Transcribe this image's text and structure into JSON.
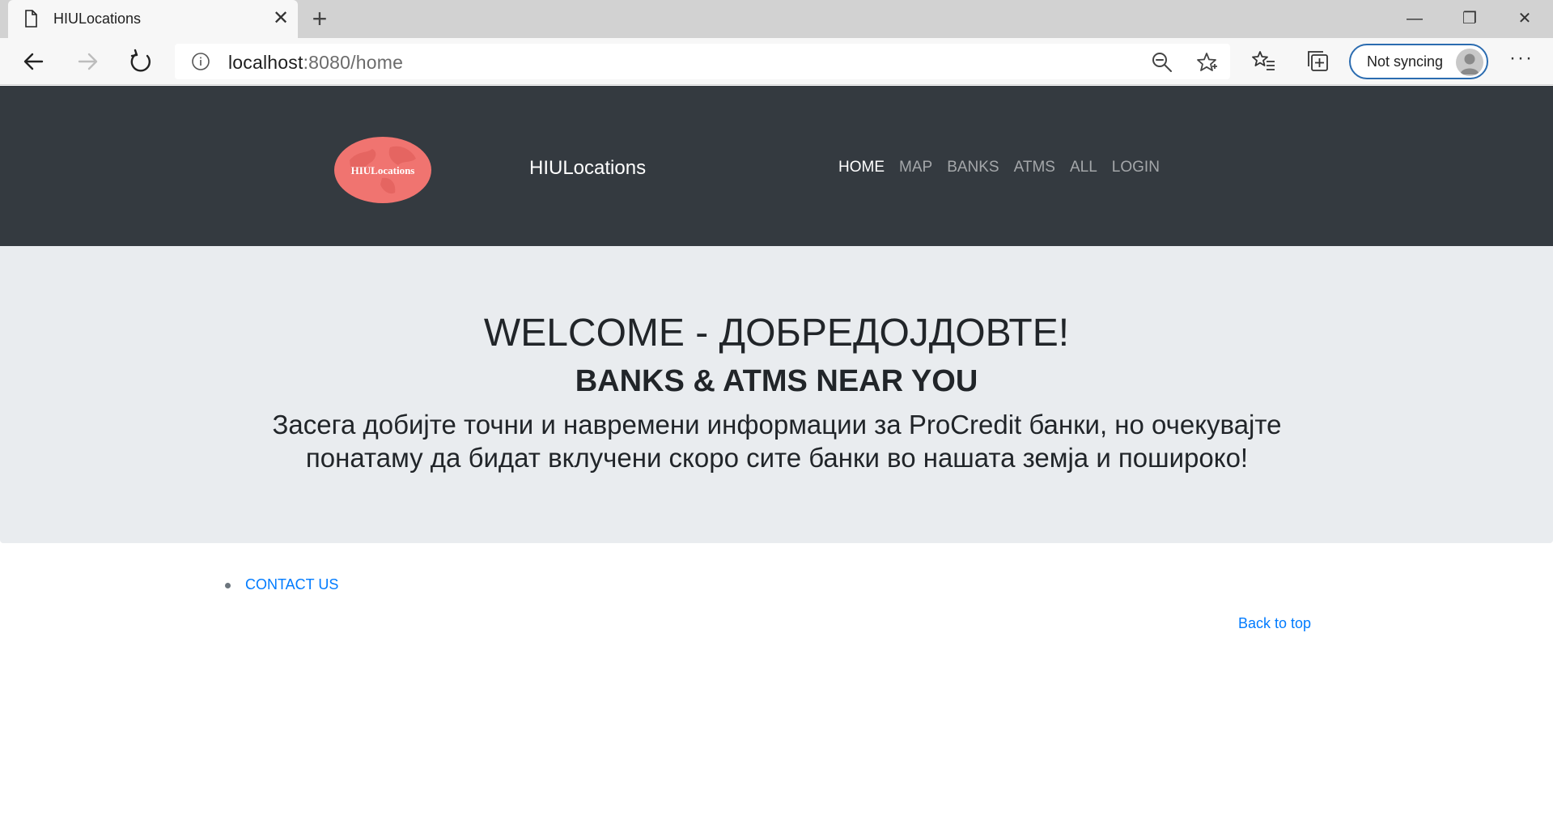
{
  "browser": {
    "tab_title": "HIULocations",
    "tab_close_glyph": "✕",
    "new_tab_glyph": "+",
    "url_host": "localhost",
    "url_rest": ":8080/home",
    "profile_label": "Not syncing",
    "more_glyph": "···",
    "window_controls": {
      "minimize": "—",
      "restore": "❐",
      "close": "✕"
    },
    "icons": [
      "page-icon",
      "back-arrow-icon",
      "forward-arrow-icon",
      "refresh-icon",
      "info-icon",
      "zoom-out-icon",
      "favorite-star-icon",
      "favorites-list-icon",
      "collections-icon",
      "avatar-icon"
    ]
  },
  "navbar": {
    "logo_text": "HIULocations",
    "brand": "HIULocations",
    "links": [
      {
        "label": "HOME",
        "active": true
      },
      {
        "label": "MAP",
        "active": false
      },
      {
        "label": "BANKS",
        "active": false
      },
      {
        "label": "ATMS",
        "active": false
      },
      {
        "label": "ALL",
        "active": false
      },
      {
        "label": "LOGIN",
        "active": false
      }
    ]
  },
  "jumbotron": {
    "title": "WELCOME - ДОБРЕДОЈДОВТЕ!",
    "subtitle": "BANKS & ATMS NEAR YOU",
    "description": "Засега добијте точни и навремени информации за ProCredit банки, но очекувајте понатаму да бидат вклучени скоро сите банки во нашата земја и пошироко!"
  },
  "footer": {
    "items": [
      {
        "label": "CONTACT US"
      }
    ],
    "back_to_top": "Back to top"
  },
  "colors": {
    "navbar_bg": "#343a40",
    "jumbotron_bg": "#e9ecef",
    "link": "#007bff",
    "logo_fill": "#f07470"
  }
}
